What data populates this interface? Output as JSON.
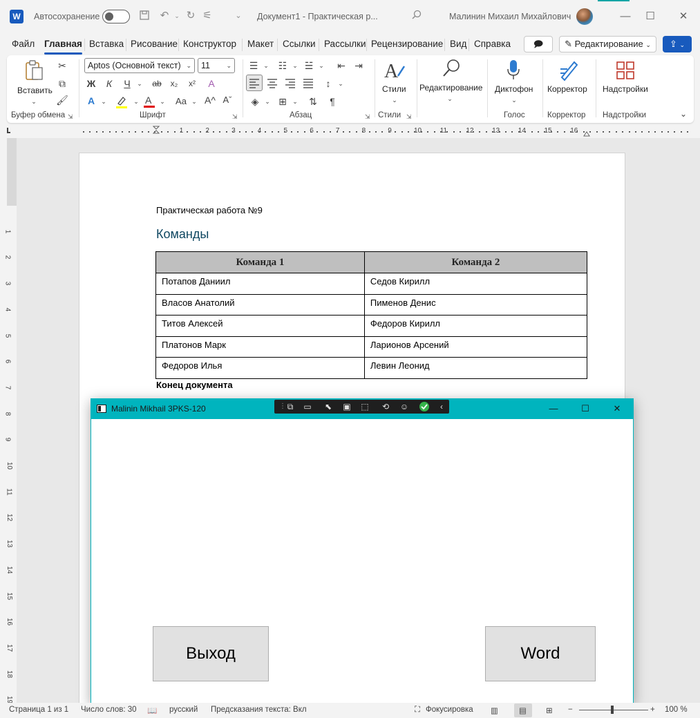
{
  "titlebar": {
    "autosave_label": "Автосохранение",
    "document_title": "Документ1 - Практическая р...",
    "user_name": "Малинин Михаил Михайлович",
    "icons": [
      "save-icon",
      "undo-icon",
      "redo-icon",
      "customize-icon",
      "search-icon"
    ]
  },
  "menu": {
    "items": [
      "Файл",
      "Главная",
      "Вставка",
      "Рисование",
      "Конструктор",
      "Макет",
      "Ссылки",
      "Рассылки",
      "Рецензирование",
      "Вид",
      "Справка"
    ],
    "active": "Главная",
    "editing_button": "Редактирование",
    "accent_color": "#185abd"
  },
  "ribbon": {
    "clipboard": {
      "paste_label": "Вставить",
      "group_label": "Буфер обмена"
    },
    "font": {
      "font_name": "Aptos (Основной текст)",
      "font_size": "11",
      "group_label": "Шрифт",
      "bold": "Ж",
      "italic": "К",
      "underline": "Ч",
      "case": "Aa"
    },
    "paragraph": {
      "group_label": "Абзац"
    },
    "styles": {
      "label": "Стили",
      "group_label": "Стили"
    },
    "editing": {
      "label": "Редактирование"
    },
    "voice": {
      "label": "Диктофон",
      "group_label": "Голос"
    },
    "editor": {
      "label": "Корректор",
      "group_label": "Корректор"
    },
    "addins": {
      "label": "Надстройки",
      "group_label": "Надстройки"
    }
  },
  "ruler": {
    "marks": [
      "1",
      "2",
      "3",
      "4",
      "5",
      "6",
      "7",
      "8",
      "9",
      "10",
      "11",
      "12",
      "13",
      "14",
      "15",
      "16"
    ],
    "vmarks": [
      "1",
      "2",
      "3",
      "4",
      "5",
      "6",
      "7",
      "8",
      "9",
      "10",
      "11",
      "12",
      "13",
      "14",
      "15",
      "16",
      "17",
      "18",
      "19"
    ]
  },
  "document": {
    "subtitle": "Практическая работа №9",
    "heading": "Команды",
    "table": {
      "headers": [
        "Команда 1",
        "Команда 2"
      ],
      "rows": [
        [
          "Потапов Даниил",
          "Седов Кирилл"
        ],
        [
          "Власов Анатолий",
          "Пименов Денис"
        ],
        [
          "Титов Алексей",
          "Федоров Кирилл"
        ],
        [
          "Платонов Марк",
          "Ларионов Арсений"
        ],
        [
          "Федоров Илья",
          "Левин Леонид"
        ]
      ]
    },
    "end_text": "Конец документа"
  },
  "form": {
    "title": "Malinin Mikhail 3PKS-120",
    "exit_button": "Выход",
    "word_button": "Word",
    "title_color": "#00b4be"
  },
  "statusbar": {
    "page": "Страница 1 из 1",
    "words": "Число слов: 30",
    "language": "русский",
    "predictions": "Предсказания текста: Вкл",
    "focus": "Фокусировка",
    "zoom": "100 %"
  }
}
